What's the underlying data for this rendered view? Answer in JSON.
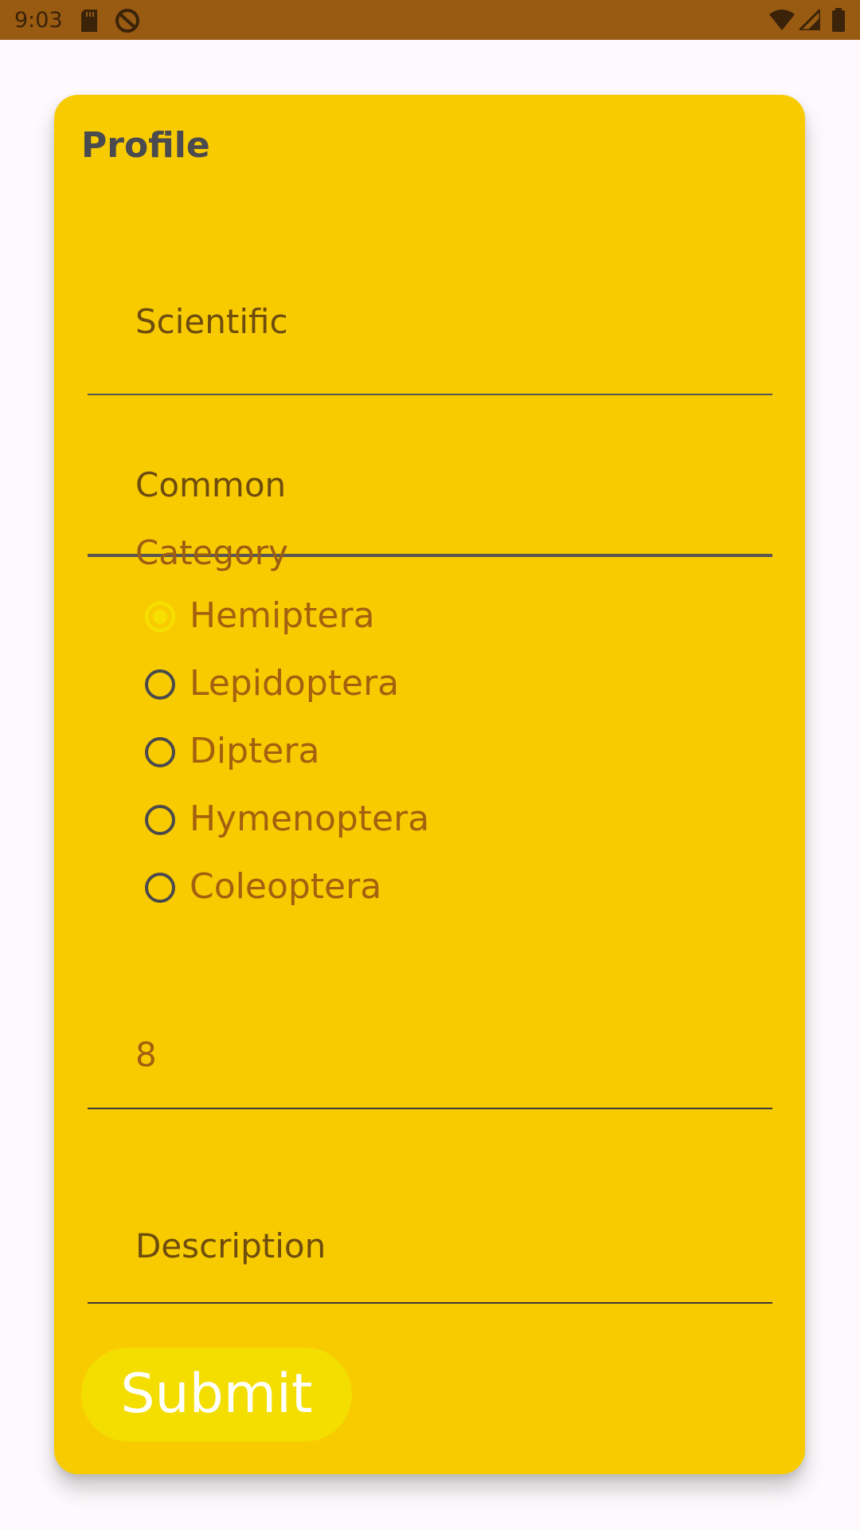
{
  "status_bar": {
    "time": "9:03",
    "icons": [
      "sd-card-icon",
      "do-not-disturb-icon",
      "wifi-icon",
      "signal-icon",
      "battery-icon"
    ]
  },
  "form": {
    "title": "Profile",
    "scientific_placeholder": "Scientific",
    "common_placeholder": "Common",
    "category_label": "Category",
    "categories": [
      {
        "label": "Hemiptera",
        "checked": true
      },
      {
        "label": "Lepidoptera",
        "checked": false
      },
      {
        "label": "Diptera",
        "checked": false
      },
      {
        "label": "Hymenoptera",
        "checked": false
      },
      {
        "label": "Coleoptera",
        "checked": false
      }
    ],
    "number_value": "8",
    "description_placeholder": "Description",
    "submit_label": "Submit"
  },
  "colors": {
    "status_bar": "#995a12",
    "card_background": "#f8cb00",
    "radio_checked": "#f6e000",
    "submit_background": "#f3de00"
  }
}
